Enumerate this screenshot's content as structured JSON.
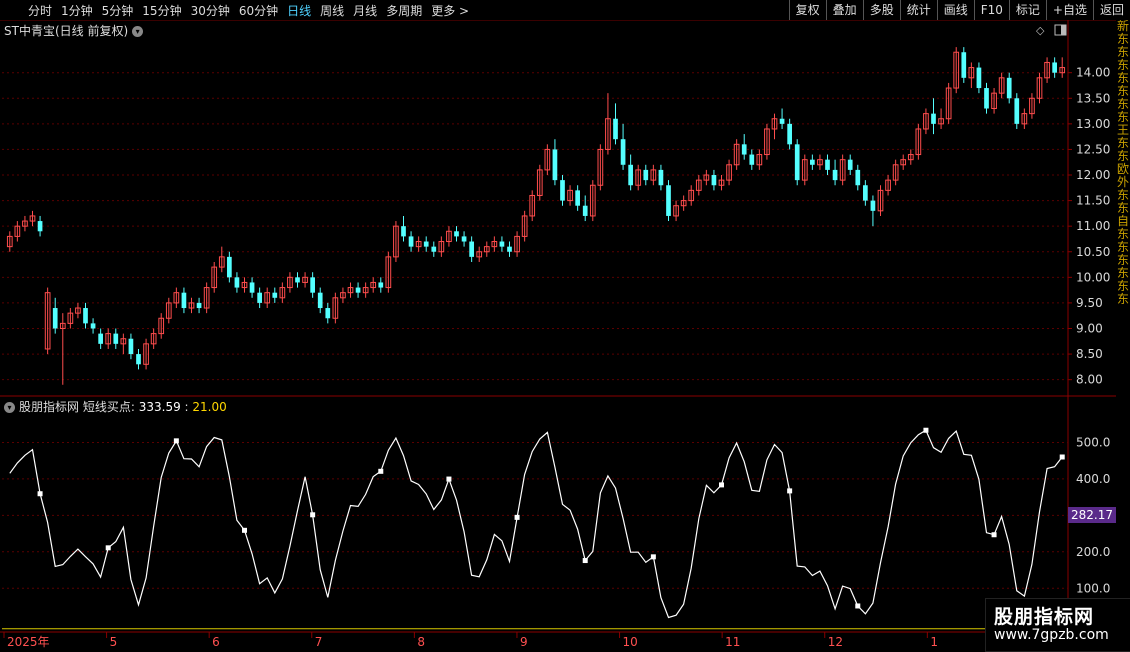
{
  "toolbar": {
    "periods": [
      "分时",
      "1分钟",
      "5分钟",
      "15分钟",
      "30分钟",
      "60分钟",
      "日线",
      "周线",
      "月线",
      "多周期",
      "更多 >"
    ],
    "active_period": "日线",
    "buttons": [
      "复权",
      "叠加",
      "多股",
      "统计",
      "画线",
      "F10",
      "标记",
      "+自选",
      "返回"
    ]
  },
  "main_chart": {
    "title": "ST中青宝(日线 前复权)",
    "price_ticks": [
      "14.00",
      "13.50",
      "13.00",
      "12.50",
      "12.00",
      "11.50",
      "11.00",
      "10.50",
      "10.00",
      "9.50",
      "9.00",
      "8.50",
      "8.00"
    ],
    "price_range": [
      7.7,
      14.6
    ],
    "candles": [
      [
        10.6,
        10.9,
        10.5,
        10.8
      ],
      [
        10.8,
        11.1,
        10.7,
        11.0
      ],
      [
        11.0,
        11.2,
        10.9,
        11.1
      ],
      [
        11.1,
        11.3,
        11.0,
        11.2
      ],
      [
        11.1,
        11.2,
        10.8,
        10.9
      ],
      [
        8.6,
        9.8,
        8.5,
        9.7
      ],
      [
        9.4,
        9.6,
        8.9,
        9.0
      ],
      [
        9.0,
        9.3,
        7.9,
        9.1
      ],
      [
        9.1,
        9.4,
        9.0,
        9.3
      ],
      [
        9.3,
        9.5,
        9.2,
        9.4
      ],
      [
        9.4,
        9.5,
        9.0,
        9.1
      ],
      [
        9.1,
        9.2,
        8.9,
        9.0
      ],
      [
        8.9,
        9.0,
        8.6,
        8.7
      ],
      [
        8.7,
        9.0,
        8.6,
        8.9
      ],
      [
        8.9,
        9.0,
        8.6,
        8.7
      ],
      [
        8.7,
        8.9,
        8.5,
        8.8
      ],
      [
        8.8,
        8.9,
        8.4,
        8.5
      ],
      [
        8.5,
        8.6,
        8.2,
        8.3
      ],
      [
        8.3,
        8.8,
        8.2,
        8.7
      ],
      [
        8.7,
        9.0,
        8.6,
        8.9
      ],
      [
        8.9,
        9.3,
        8.8,
        9.2
      ],
      [
        9.2,
        9.6,
        9.1,
        9.5
      ],
      [
        9.5,
        9.8,
        9.4,
        9.7
      ],
      [
        9.7,
        9.8,
        9.3,
        9.4
      ],
      [
        9.4,
        9.6,
        9.3,
        9.5
      ],
      [
        9.5,
        9.6,
        9.3,
        9.4
      ],
      [
        9.4,
        9.9,
        9.3,
        9.8
      ],
      [
        9.8,
        10.3,
        9.7,
        10.2
      ],
      [
        10.2,
        10.6,
        10.1,
        10.4
      ],
      [
        10.4,
        10.5,
        9.9,
        10.0
      ],
      [
        10.0,
        10.1,
        9.7,
        9.8
      ],
      [
        9.8,
        10.0,
        9.7,
        9.9
      ],
      [
        9.9,
        10.0,
        9.6,
        9.7
      ],
      [
        9.7,
        9.8,
        9.4,
        9.5
      ],
      [
        9.5,
        9.8,
        9.4,
        9.7
      ],
      [
        9.7,
        9.8,
        9.5,
        9.6
      ],
      [
        9.6,
        9.9,
        9.5,
        9.8
      ],
      [
        9.8,
        10.1,
        9.7,
        10.0
      ],
      [
        10.0,
        10.1,
        9.8,
        9.9
      ],
      [
        9.9,
        10.1,
        9.8,
        10.0
      ],
      [
        10.0,
        10.1,
        9.6,
        9.7
      ],
      [
        9.7,
        9.8,
        9.3,
        9.4
      ],
      [
        9.4,
        9.5,
        9.1,
        9.2
      ],
      [
        9.2,
        9.7,
        9.1,
        9.6
      ],
      [
        9.6,
        9.8,
        9.5,
        9.7
      ],
      [
        9.7,
        9.9,
        9.6,
        9.8
      ],
      [
        9.8,
        9.9,
        9.6,
        9.7
      ],
      [
        9.7,
        9.9,
        9.6,
        9.8
      ],
      [
        9.8,
        10.0,
        9.7,
        9.9
      ],
      [
        9.9,
        10.0,
        9.7,
        9.8
      ],
      [
        9.8,
        10.5,
        9.7,
        10.4
      ],
      [
        10.4,
        11.1,
        10.3,
        11.0
      ],
      [
        11.0,
        11.2,
        10.7,
        10.8
      ],
      [
        10.8,
        10.9,
        10.5,
        10.6
      ],
      [
        10.6,
        10.8,
        10.5,
        10.7
      ],
      [
        10.7,
        10.8,
        10.5,
        10.6
      ],
      [
        10.6,
        10.7,
        10.4,
        10.5
      ],
      [
        10.5,
        10.8,
        10.4,
        10.7
      ],
      [
        10.7,
        11.0,
        10.6,
        10.9
      ],
      [
        10.9,
        11.0,
        10.7,
        10.8
      ],
      [
        10.8,
        10.9,
        10.6,
        10.7
      ],
      [
        10.7,
        10.8,
        10.3,
        10.4
      ],
      [
        10.4,
        10.6,
        10.3,
        10.5
      ],
      [
        10.5,
        10.7,
        10.4,
        10.6
      ],
      [
        10.6,
        10.8,
        10.5,
        10.7
      ],
      [
        10.7,
        10.8,
        10.5,
        10.6
      ],
      [
        10.6,
        10.7,
        10.4,
        10.5
      ],
      [
        10.5,
        10.9,
        10.4,
        10.8
      ],
      [
        10.8,
        11.3,
        10.7,
        11.2
      ],
      [
        11.2,
        11.7,
        11.1,
        11.6
      ],
      [
        11.6,
        12.2,
        11.5,
        12.1
      ],
      [
        12.1,
        12.6,
        12.0,
        12.5
      ],
      [
        12.5,
        12.7,
        11.8,
        11.9
      ],
      [
        11.9,
        12.0,
        11.4,
        11.5
      ],
      [
        11.5,
        11.8,
        11.4,
        11.7
      ],
      [
        11.7,
        11.8,
        11.3,
        11.4
      ],
      [
        11.4,
        11.6,
        11.1,
        11.2
      ],
      [
        11.2,
        11.9,
        11.1,
        11.8
      ],
      [
        11.8,
        12.6,
        11.7,
        12.5
      ],
      [
        12.5,
        13.6,
        12.4,
        13.1
      ],
      [
        13.1,
        13.4,
        12.6,
        12.7
      ],
      [
        12.7,
        13.0,
        12.1,
        12.2
      ],
      [
        12.2,
        12.4,
        11.7,
        11.8
      ],
      [
        11.8,
        12.2,
        11.7,
        12.1
      ],
      [
        12.1,
        12.2,
        11.8,
        11.9
      ],
      [
        11.9,
        12.2,
        11.8,
        12.1
      ],
      [
        12.1,
        12.2,
        11.7,
        11.8
      ],
      [
        11.8,
        11.9,
        11.1,
        11.2
      ],
      [
        11.2,
        11.5,
        11.1,
        11.4
      ],
      [
        11.4,
        11.6,
        11.3,
        11.5
      ],
      [
        11.5,
        11.8,
        11.4,
        11.7
      ],
      [
        11.7,
        12.0,
        11.6,
        11.9
      ],
      [
        11.9,
        12.1,
        11.8,
        12.0
      ],
      [
        12.0,
        12.1,
        11.7,
        11.8
      ],
      [
        11.8,
        12.0,
        11.7,
        11.9
      ],
      [
        11.9,
        12.3,
        11.8,
        12.2
      ],
      [
        12.2,
        12.7,
        12.1,
        12.6
      ],
      [
        12.6,
        12.8,
        12.3,
        12.4
      ],
      [
        12.4,
        12.5,
        12.1,
        12.2
      ],
      [
        12.2,
        12.5,
        12.1,
        12.4
      ],
      [
        12.4,
        13.0,
        12.3,
        12.9
      ],
      [
        12.9,
        13.2,
        12.7,
        13.1
      ],
      [
        13.1,
        13.3,
        12.9,
        13.0
      ],
      [
        13.0,
        13.1,
        12.5,
        12.6
      ],
      [
        12.6,
        12.7,
        11.8,
        11.9
      ],
      [
        11.9,
        12.4,
        11.8,
        12.3
      ],
      [
        12.3,
        12.4,
        12.1,
        12.2
      ],
      [
        12.2,
        12.4,
        12.1,
        12.3
      ],
      [
        12.3,
        12.4,
        12.0,
        12.1
      ],
      [
        12.1,
        12.3,
        11.8,
        11.9
      ],
      [
        11.9,
        12.4,
        11.8,
        12.3
      ],
      [
        12.3,
        12.4,
        12.0,
        12.1
      ],
      [
        12.1,
        12.2,
        11.7,
        11.8
      ],
      [
        11.8,
        11.9,
        11.4,
        11.5
      ],
      [
        11.5,
        11.6,
        11.0,
        11.3
      ],
      [
        11.3,
        11.8,
        11.2,
        11.7
      ],
      [
        11.7,
        12.0,
        11.6,
        11.9
      ],
      [
        11.9,
        12.3,
        11.8,
        12.2
      ],
      [
        12.2,
        12.4,
        12.1,
        12.3
      ],
      [
        12.3,
        12.5,
        12.2,
        12.4
      ],
      [
        12.4,
        13.0,
        12.3,
        12.9
      ],
      [
        12.9,
        13.3,
        12.8,
        13.2
      ],
      [
        13.2,
        13.5,
        12.8,
        13.0
      ],
      [
        13.0,
        13.3,
        12.9,
        13.1
      ],
      [
        13.1,
        13.8,
        13.0,
        13.7
      ],
      [
        13.7,
        14.5,
        13.6,
        14.4
      ],
      [
        14.4,
        14.5,
        13.8,
        13.9
      ],
      [
        13.9,
        14.2,
        13.7,
        14.1
      ],
      [
        14.1,
        14.2,
        13.6,
        13.7
      ],
      [
        13.7,
        13.8,
        13.2,
        13.3
      ],
      [
        13.3,
        13.7,
        13.2,
        13.6
      ],
      [
        13.6,
        14.0,
        13.5,
        13.9
      ],
      [
        13.9,
        14.0,
        13.4,
        13.5
      ],
      [
        13.5,
        13.6,
        12.9,
        13.0
      ],
      [
        13.0,
        13.3,
        12.9,
        13.2
      ],
      [
        13.2,
        13.6,
        13.1,
        13.5
      ],
      [
        13.5,
        14.0,
        13.4,
        13.9
      ],
      [
        13.9,
        14.3,
        13.8,
        14.2
      ],
      [
        14.2,
        14.3,
        13.9,
        14.0
      ],
      [
        14.0,
        14.3,
        13.9,
        14.1
      ]
    ]
  },
  "indicator": {
    "title_prefix": "股朋指标网",
    "name": "短线买点:",
    "value1": "333.59",
    "sep": " : ",
    "value2": "21.00",
    "ticks": [
      "500.0",
      "400.0",
      "200.0",
      "100.0"
    ],
    "current_badge": "282.17",
    "range": [
      -20,
      600
    ],
    "baseline": 0
  },
  "date_labels": [
    "2025年",
    "5",
    "6",
    "7",
    "8",
    "9",
    "10",
    "11",
    "12",
    "1"
  ],
  "right_edge_chars": [
    "新",
    "东",
    "东",
    "东",
    "东",
    "东",
    "东",
    "东",
    "王",
    "东",
    "东",
    "欧",
    "外",
    "东",
    "东",
    "自",
    "东",
    "东",
    "东",
    "东",
    "东",
    "东"
  ],
  "watermark": {
    "line1": "股朋指标网",
    "line2": "www.7gpzb.com"
  },
  "colors": {
    "up": "#ff4d4d",
    "down": "#54ffff",
    "grid": "#5a0000",
    "axis": "#8a0000",
    "active": "#4fd2ff",
    "indicator_line": "#ffffff",
    "baseline": "#d8c800",
    "badge_bg": "#5a2a8a"
  }
}
